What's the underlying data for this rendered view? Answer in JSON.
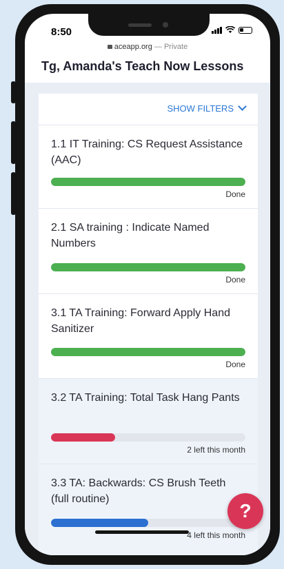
{
  "status_bar": {
    "time": "8:50"
  },
  "browser": {
    "domain": "aceapp.org",
    "suffix": " — Private"
  },
  "page": {
    "title": "Tg, Amanda's Teach Now Lessons"
  },
  "filters": {
    "label": "SHOW FILTERS"
  },
  "lessons": [
    {
      "title": "1.1  IT Training: CS Request Assistance (AAC)",
      "status": "Done",
      "progress": 1.0,
      "color": "#4caf50"
    },
    {
      "title": "2.1  SA training : Indicate Named Numbers",
      "status": "Done",
      "progress": 1.0,
      "color": "#4caf50"
    },
    {
      "title": "3.1  TA Training: Forward Apply Hand Sanitizer",
      "status": "Done",
      "progress": 1.0,
      "color": "#4caf50"
    },
    {
      "title": "3.2  TA Training: Total Task Hang Pants",
      "status": "2 left this month",
      "progress": 0.33,
      "color": "#d93657"
    },
    {
      "title": "3.3  TA: Backwards: CS Brush Teeth (full routine)",
      "status": "4 left this month",
      "progress": 0.5,
      "color": "#2b6fd1"
    }
  ],
  "help": {
    "label": "?"
  }
}
